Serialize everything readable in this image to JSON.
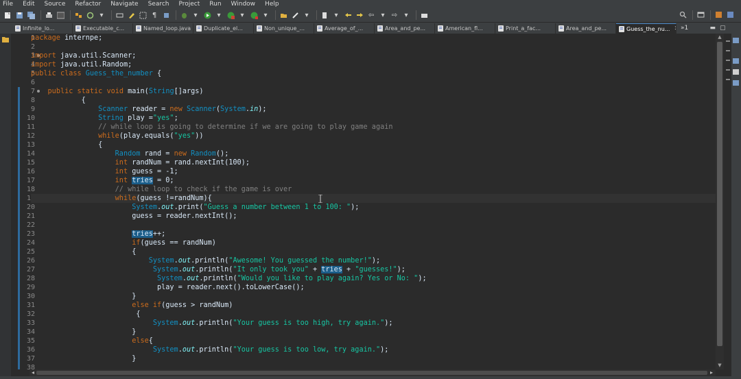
{
  "menu": [
    "File",
    "Edit",
    "Source",
    "Refactor",
    "Navigate",
    "Search",
    "Project",
    "Run",
    "Window",
    "Help"
  ],
  "toolbar_icons": [
    "new-icon",
    "save-icon",
    "save-all-icon",
    "print-icon",
    "debug-icon",
    "run-icon",
    "external-tools-icon",
    "new-java-project-icon",
    "new-package-icon",
    "new-class-icon",
    "open-type-icon",
    "search-icon",
    "back-icon",
    "forward-icon"
  ],
  "colors": {
    "background": "#2b2b2b",
    "keyword": "#cc6c1d",
    "type": "#1290c3",
    "string": "#17c6a3",
    "comment": "#808080",
    "static_field": "#80f2f6",
    "occurrence_highlight": "#1b5e8a",
    "tab_active_border": "#4a88c7"
  },
  "tabs": [
    {
      "label": "Infinite_lo...",
      "active": false
    },
    {
      "label": "Executable_c...",
      "active": false
    },
    {
      "label": "Named_loop.java",
      "active": false
    },
    {
      "label": "Duplicate_el...",
      "active": false
    },
    {
      "label": "Non_unique_...",
      "active": false
    },
    {
      "label": "Average_of_...",
      "active": false
    },
    {
      "label": "Area_and_pe...",
      "active": false
    },
    {
      "label": "American_fl...",
      "active": false
    },
    {
      "label": "Print_a_fac...",
      "active": false
    },
    {
      "label": "Area_and_pe...",
      "active": false
    },
    {
      "label": "Guess_the_nu...",
      "active": true
    }
  ],
  "tab_overflow": "»1",
  "editor": {
    "current_line": 19,
    "lines": [
      {
        "n": "1",
        "parts": [
          [
            "k",
            "package"
          ],
          [
            "",
            " internpe;"
          ]
        ]
      },
      {
        "n": "2",
        "parts": []
      },
      {
        "n": "3",
        "fold": true,
        "parts": [
          [
            "k",
            "import"
          ],
          [
            "",
            " java.util.Scanner;"
          ]
        ]
      },
      {
        "n": "4",
        "parts": [
          [
            "k",
            "import"
          ],
          [
            "",
            " java.util.Random;"
          ]
        ]
      },
      {
        "n": "5",
        "parts": [
          [
            "k",
            "public"
          ],
          [
            "",
            " "
          ],
          [
            "k",
            "class"
          ],
          [
            "",
            " "
          ],
          [
            "t",
            "Guess_the_number"
          ],
          [
            "",
            " {"
          ]
        ]
      },
      {
        "n": "6",
        "parts": []
      },
      {
        "n": "7",
        "fold": true,
        "parts": [
          [
            "",
            "    "
          ],
          [
            "k",
            "public"
          ],
          [
            "",
            " "
          ],
          [
            "k",
            "static"
          ],
          [
            "",
            " "
          ],
          [
            "k",
            "void"
          ],
          [
            "",
            " main("
          ],
          [
            "t",
            "String"
          ],
          [
            "",
            "[]args)"
          ]
        ]
      },
      {
        "n": "8",
        "parts": [
          [
            "",
            "            {"
          ]
        ]
      },
      {
        "n": "9",
        "parts": [
          [
            "",
            "                "
          ],
          [
            "t",
            "Scanner"
          ],
          [
            "",
            " reader = "
          ],
          [
            "k",
            "new"
          ],
          [
            "",
            " "
          ],
          [
            "t",
            "Scanner"
          ],
          [
            "",
            "("
          ],
          [
            "t",
            "System"
          ],
          [
            "",
            "."
          ],
          [
            "f",
            "in"
          ],
          [
            "",
            ");"
          ]
        ]
      },
      {
        "n": "10",
        "parts": [
          [
            "",
            "                "
          ],
          [
            "t",
            "String"
          ],
          [
            "",
            " play ="
          ],
          [
            "s",
            "\"yes\""
          ],
          [
            "",
            ";"
          ]
        ]
      },
      {
        "n": "11",
        "parts": [
          [
            "",
            "                "
          ],
          [
            "c",
            "// while loop is going to determine if we are going to play game again"
          ]
        ]
      },
      {
        "n": "12",
        "parts": [
          [
            "",
            "                "
          ],
          [
            "k",
            "while"
          ],
          [
            "",
            "(play.equals("
          ],
          [
            "s",
            "\"yes\""
          ],
          [
            "",
            "))"
          ]
        ]
      },
      {
        "n": "13",
        "parts": [
          [
            "",
            "                {"
          ]
        ]
      },
      {
        "n": "14",
        "parts": [
          [
            "",
            "                    "
          ],
          [
            "t",
            "Random"
          ],
          [
            "",
            " rand = "
          ],
          [
            "k",
            "new"
          ],
          [
            "",
            " "
          ],
          [
            "t",
            "Random"
          ],
          [
            "",
            "();"
          ]
        ]
      },
      {
        "n": "15",
        "parts": [
          [
            "",
            "                    "
          ],
          [
            "k",
            "int"
          ],
          [
            "",
            " randNum = rand.nextInt(100);"
          ]
        ]
      },
      {
        "n": "16",
        "parts": [
          [
            "",
            "                    "
          ],
          [
            "k",
            "int"
          ],
          [
            "",
            " guess = -1;"
          ]
        ]
      },
      {
        "n": "17",
        "parts": [
          [
            "",
            "                    "
          ],
          [
            "k",
            "int"
          ],
          [
            "",
            " "
          ],
          [
            "occ",
            "tries"
          ],
          [
            "",
            " = 0;"
          ]
        ]
      },
      {
        "n": "18",
        "parts": [
          [
            "",
            "                    "
          ],
          [
            "c",
            "// while loop to check if the game is over"
          ]
        ]
      },
      {
        "n": "19",
        "parts": [
          [
            "",
            "                    "
          ],
          [
            "k",
            "while"
          ],
          [
            "",
            "(guess !=randNum){"
          ]
        ]
      },
      {
        "n": "20",
        "parts": [
          [
            "",
            "                        "
          ],
          [
            "t",
            "System"
          ],
          [
            "",
            "."
          ],
          [
            "f",
            "out"
          ],
          [
            "",
            ".print("
          ],
          [
            "s",
            "\"Guess a number between 1 to 100: \""
          ],
          [
            "",
            ");"
          ]
        ]
      },
      {
        "n": "21",
        "parts": [
          [
            "",
            "                        guess = reader.nextInt();"
          ]
        ]
      },
      {
        "n": "22",
        "parts": []
      },
      {
        "n": "23",
        "parts": [
          [
            "",
            "                        "
          ],
          [
            "occ",
            "tries"
          ],
          [
            "",
            "++;"
          ]
        ]
      },
      {
        "n": "24",
        "parts": [
          [
            "",
            "                        "
          ],
          [
            "k",
            "if"
          ],
          [
            "",
            "(guess == randNum)"
          ]
        ]
      },
      {
        "n": "25",
        "parts": [
          [
            "",
            "                        {"
          ]
        ]
      },
      {
        "n": "26",
        "parts": [
          [
            "",
            "                            "
          ],
          [
            "t",
            "System"
          ],
          [
            "",
            "."
          ],
          [
            "f",
            "out"
          ],
          [
            "",
            ".println("
          ],
          [
            "s",
            "\"Awesome! You guessed the number!\""
          ],
          [
            "",
            ");"
          ]
        ]
      },
      {
        "n": "27",
        "parts": [
          [
            "",
            "                             "
          ],
          [
            "t",
            "System"
          ],
          [
            "",
            "."
          ],
          [
            "f",
            "out"
          ],
          [
            "",
            ".println("
          ],
          [
            "s",
            "\"It only took you\""
          ],
          [
            "",
            " + "
          ],
          [
            "occ",
            "tries"
          ],
          [
            "",
            " + "
          ],
          [
            "s",
            "\"guesses!\""
          ],
          [
            "",
            ");"
          ]
        ]
      },
      {
        "n": "28",
        "parts": [
          [
            "",
            "                              "
          ],
          [
            "t",
            "System"
          ],
          [
            "",
            "."
          ],
          [
            "f",
            "out"
          ],
          [
            "",
            ".println("
          ],
          [
            "s",
            "\"Would you like to play again? Yes or No: \""
          ],
          [
            "",
            ");"
          ]
        ]
      },
      {
        "n": "29",
        "parts": [
          [
            "",
            "                              play = reader.next().toLowerCase();"
          ]
        ]
      },
      {
        "n": "30",
        "parts": [
          [
            "",
            "                        }"
          ]
        ]
      },
      {
        "n": "31",
        "parts": [
          [
            "",
            "                        "
          ],
          [
            "k",
            "else"
          ],
          [
            "",
            " "
          ],
          [
            "k",
            "if"
          ],
          [
            "",
            "(guess > randNum)"
          ]
        ]
      },
      {
        "n": "32",
        "parts": [
          [
            "",
            "                         {"
          ]
        ]
      },
      {
        "n": "33",
        "parts": [
          [
            "",
            "                             "
          ],
          [
            "t",
            "System"
          ],
          [
            "",
            "."
          ],
          [
            "f",
            "out"
          ],
          [
            "",
            ".println("
          ],
          [
            "s",
            "\"Your guess is too high, try again.\""
          ],
          [
            "",
            ");"
          ]
        ]
      },
      {
        "n": "34",
        "parts": [
          [
            "",
            "                        }"
          ]
        ]
      },
      {
        "n": "35",
        "parts": [
          [
            "",
            "                        "
          ],
          [
            "k",
            "else"
          ],
          [
            "",
            "{"
          ]
        ]
      },
      {
        "n": "36",
        "parts": [
          [
            "",
            "                             "
          ],
          [
            "t",
            "System"
          ],
          [
            "",
            "."
          ],
          [
            "f",
            "out"
          ],
          [
            "",
            ".println("
          ],
          [
            "s",
            "\"Your guess is too low, try again.\""
          ],
          [
            "",
            ");"
          ]
        ]
      },
      {
        "n": "37",
        "parts": [
          [
            "",
            "                        }"
          ]
        ]
      },
      {
        "n": "38",
        "parts": []
      }
    ]
  }
}
